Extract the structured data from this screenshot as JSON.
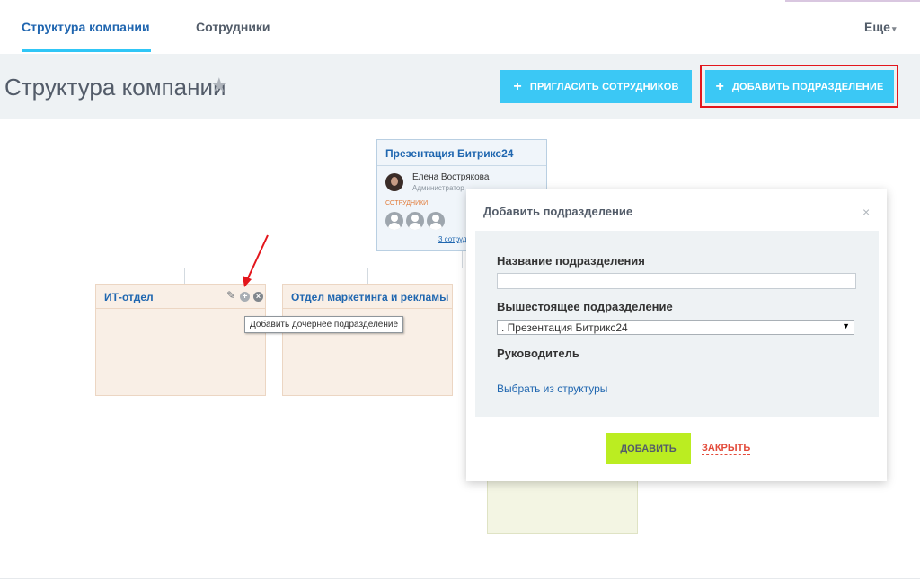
{
  "tabs": {
    "structure": "Структура компании",
    "employees": "Сотрудники",
    "more": "Еще"
  },
  "header": {
    "title": "Структура компании",
    "invite_button": "ПРИГЛАСИТЬ СОТРУДНИКОВ",
    "add_department_button": "ДОБАВИТЬ ПОДРАЗДЕЛЕНИЕ"
  },
  "org": {
    "root": {
      "title": "Презентация Битрикс24",
      "head_name": "Елена Вострякова",
      "head_role": "Администратор",
      "staff_label": "СОТРУДНИКИ",
      "staff_link": "3 сотруд"
    },
    "departments": [
      {
        "title": "ИТ-отдел"
      },
      {
        "title": "Отдел маркетинга и рекламы"
      }
    ],
    "tooltip": "Добавить дочернее подразделение"
  },
  "modal": {
    "title": "Добавить подразделение",
    "close_symbol": "×",
    "name_label": "Название подразделения",
    "name_value": "",
    "parent_label": "Вышестоящее подразделение",
    "parent_value": ". Презентация Битрикс24",
    "head_label": "Руководитель",
    "pick_link": "Выбрать из структуры",
    "add_button": "ДОБАВИТЬ",
    "close_button": "ЗАКРЫТЬ"
  },
  "colors": {
    "accent_blue": "#3bc8f5",
    "link_blue": "#2067b0",
    "highlight_red": "#e3161c",
    "add_green": "#bbed21"
  }
}
